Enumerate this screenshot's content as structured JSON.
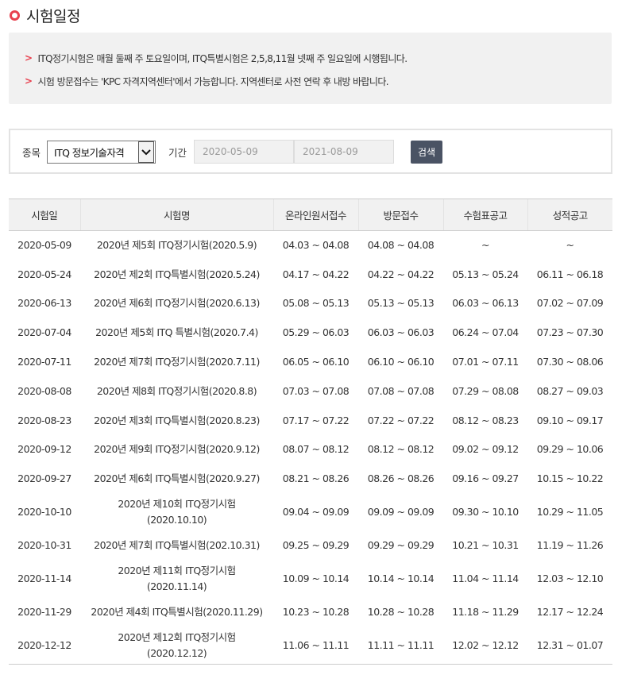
{
  "page": {
    "title": "시험일정"
  },
  "notice": [
    "ITQ정기시험은 매월 둘째 주 토요일이며, ITQ특별시험은 2,5,8,11월 넷째 주 일요일에 시행됩니다.",
    "시험 방문접수는 'KPC 자격지역센터'에서 가능합니다. 지역센터로 사전 연락 후 내방 바랍니다."
  ],
  "search": {
    "type_label": "종목",
    "type_value": "ITQ 정보기술자격",
    "period_label": "기간",
    "start_date": "2020-05-09",
    "end_date": "2021-08-09",
    "button_label": "검색"
  },
  "table": {
    "headers": [
      "시험일",
      "시험명",
      "온라인원서접수",
      "방문접수",
      "수험표공고",
      "성적공고"
    ],
    "rows": [
      [
        "2020-05-09",
        "2020년 제5회 ITQ정기시험(2020.5.9)",
        "04.03 ~ 04.08",
        "04.08 ~ 04.08",
        "~",
        "~"
      ],
      [
        "2020-05-24",
        "2020년 제2회 ITQ특별시험(2020.5.24)",
        "04.17 ~ 04.22",
        "04.22 ~ 04.22",
        "05.13 ~ 05.24",
        "06.11 ~ 06.18"
      ],
      [
        "2020-06-13",
        "2020년 제6회 ITQ정기시험(2020.6.13)",
        "05.08 ~ 05.13",
        "05.13 ~ 05.13",
        "06.03 ~ 06.13",
        "07.02 ~ 07.09"
      ],
      [
        "2020-07-04",
        "2020년 제5회 ITQ 특별시험(2020.7.4)",
        "05.29 ~ 06.03",
        "06.03 ~ 06.03",
        "06.24 ~ 07.04",
        "07.23 ~ 07.30"
      ],
      [
        "2020-07-11",
        "2020년 제7회 ITQ정기시험(2020.7.11)",
        "06.05 ~ 06.10",
        "06.10 ~ 06.10",
        "07.01 ~ 07.11",
        "07.30 ~ 08.06"
      ],
      [
        "2020-08-08",
        "2020년 제8회 ITQ정기시험(2020.8.8)",
        "07.03 ~ 07.08",
        "07.08 ~ 07.08",
        "07.29 ~ 08.08",
        "08.27 ~ 09.03"
      ],
      [
        "2020-08-23",
        "2020년 제3회 ITQ특별시험(2020.8.23)",
        "07.17 ~ 07.22",
        "07.22 ~ 07.22",
        "08.12 ~ 08.23",
        "09.10 ~ 09.17"
      ],
      [
        "2020-09-12",
        "2020년 제9회 ITQ정기시험(2020.9.12)",
        "08.07 ~ 08.12",
        "08.12 ~ 08.12",
        "09.02 ~ 09.12",
        "09.29 ~ 10.06"
      ],
      [
        "2020-09-27",
        "2020년 제6회 ITQ특별시험(2020.9.27)",
        "08.21 ~ 08.26",
        "08.26 ~ 08.26",
        "09.16 ~ 09.27",
        "10.15 ~ 10.22"
      ],
      [
        "2020-10-10",
        "2020년 제10회 ITQ정기시험(2020.10.10)",
        "09.04 ~ 09.09",
        "09.09 ~ 09.09",
        "09.30 ~ 10.10",
        "10.29 ~ 11.05"
      ],
      [
        "2020-10-31",
        "2020년 제7회 ITQ특별시험(202.10.31)",
        "09.25 ~ 09.29",
        "09.29 ~ 09.29",
        "10.21 ~ 10.31",
        "11.19 ~ 11.26"
      ],
      [
        "2020-11-14",
        "2020년 제11회 ITQ정기시험(2020.11.14)",
        "10.09 ~ 10.14",
        "10.14 ~ 10.14",
        "11.04 ~ 11.14",
        "12.03 ~ 12.10"
      ],
      [
        "2020-11-29",
        "2020년 제4회 ITQ특별시험(2020.11.29)",
        "10.23 ~ 10.28",
        "10.28 ~ 10.28",
        "11.18 ~ 11.29",
        "12.17 ~ 12.24"
      ],
      [
        "2020-12-12",
        "2020년 제12회 ITQ정기시험(2020.12.12)",
        "11.06 ~ 11.11",
        "11.11 ~ 11.11",
        "12.02 ~ 12.12",
        "12.31 ~ 01.07"
      ]
    ]
  }
}
